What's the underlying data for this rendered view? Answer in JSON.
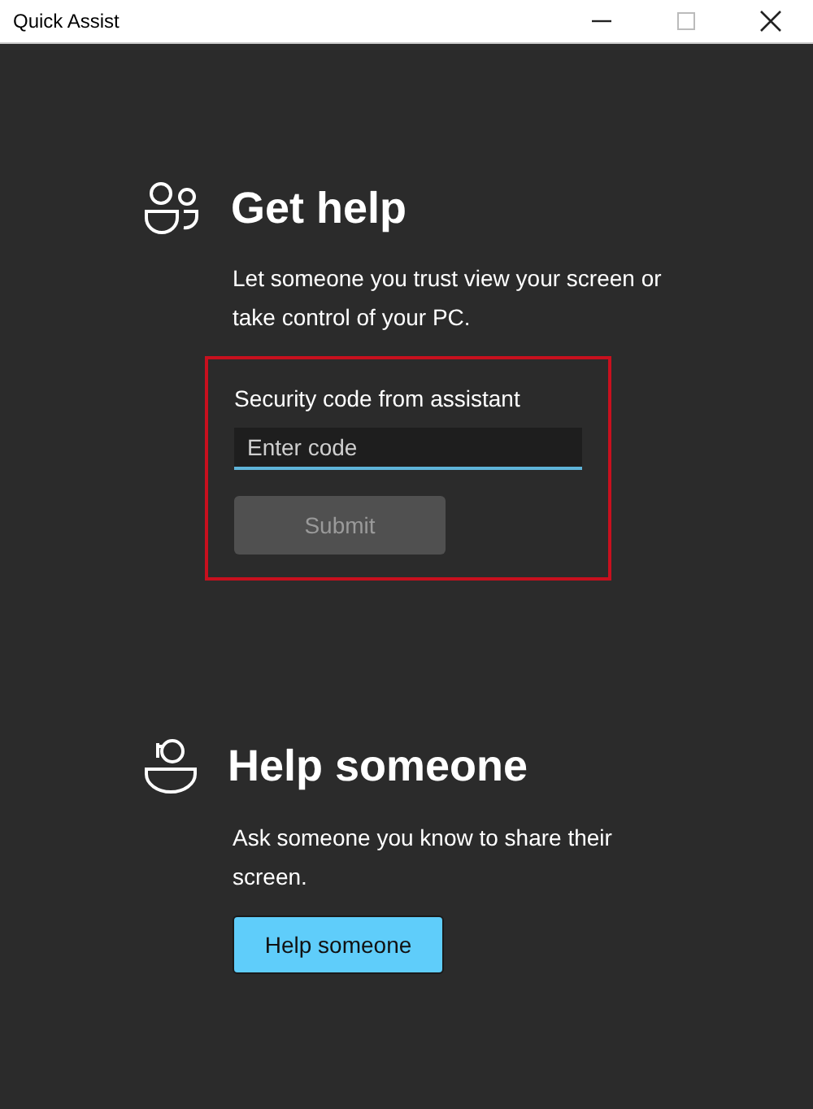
{
  "window": {
    "title": "Quick Assist"
  },
  "get_help": {
    "heading": "Get help",
    "description": "Let someone you trust view your screen or take control of your PC.",
    "highlighted": true,
    "field_label": "Security code from assistant",
    "code_field": {
      "placeholder": "Enter code"
    },
    "submit": {
      "label": "Submit",
      "disabled": true
    }
  },
  "help_someone": {
    "heading": "Help someone",
    "description": "Ask someone you know to share their screen.",
    "button": {
      "label": "Help someone",
      "disabled": false
    }
  }
}
